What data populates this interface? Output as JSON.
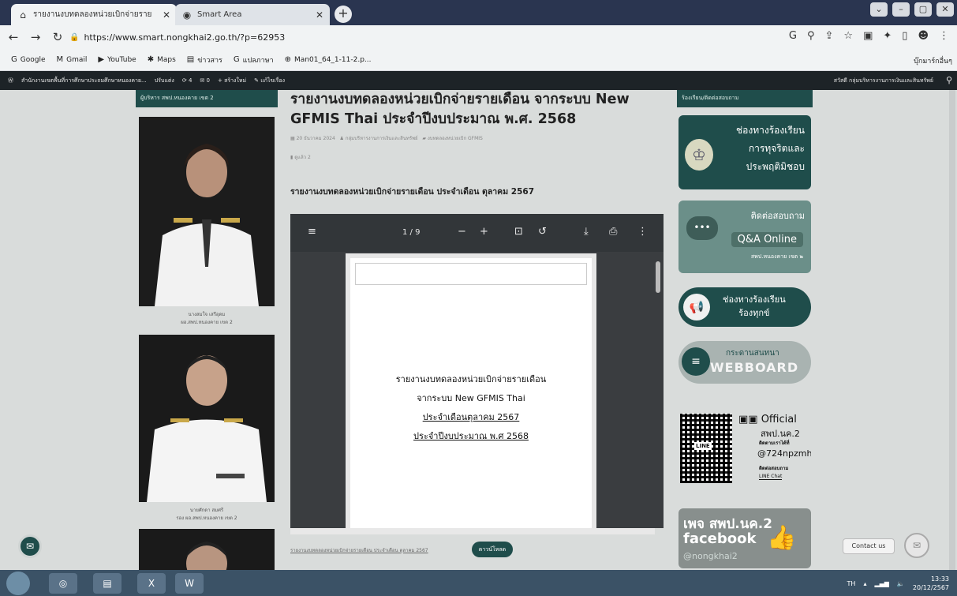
{
  "browser": {
    "tabs": [
      {
        "title": "รายงานงบทดลองหน่วยเบิกจ่ายราย",
        "active": true
      },
      {
        "title": "Smart Area",
        "active": false
      }
    ],
    "new_tab": "+",
    "url": "https://www.smart.nongkhai2.go.th/?p=62953",
    "bookmarks": [
      {
        "icon": "G",
        "label": "Google"
      },
      {
        "icon": "M",
        "label": "Gmail"
      },
      {
        "icon": "▶",
        "label": "YouTube"
      },
      {
        "icon": "✱",
        "label": "Maps"
      },
      {
        "icon": "▤",
        "label": "ข่าวสาร"
      },
      {
        "icon": "G",
        "label": "แปลภาษา"
      },
      {
        "icon": "⊕",
        "label": "Man01_64_1-11-2.p..."
      }
    ],
    "bookmarks_right": "บุ๊กมาร์กอื่นๆ"
  },
  "wp_admin": {
    "site": "สำนักงานเขตพื้นที่การศึกษาประถมศึกษาหนองคาย...",
    "customize": "ปรับแต่ง",
    "updates": "4",
    "comments": "0",
    "new": "สร้างใหม่",
    "edit": "แก้ไขเรื่อง",
    "right": "สวัสดี กลุ่มบริหารงานการเงินและสินทรัพย์"
  },
  "left_sidebar": {
    "heading": "ผู้บริหาร สพป.หนองคาย เขต 2",
    "person1_name": "นางสมใจ เสรีอุดม",
    "person1_role": "ผอ.สพป.หนองคาย เขต 2",
    "person2_name": "นายศักดา สมศรี",
    "person2_role": "รอง ผอ.สพป.หนองคาย เขต 2"
  },
  "post": {
    "title": "รายงานงบทดลองหน่วยเบิกจ่ายรายเดือน จากระบบ New GFMIS Thai ประจำปีงบประมาณ พ.ศ. 2568",
    "meta_date": "20 ธันวาคม 2024",
    "meta_author": "กลุ่มบริหารงานการเงินและสินทรัพย์",
    "meta_category": "งบทดลองหน่วยเบิก GFMIS",
    "meta_views": "ดูแล้ว 2",
    "subheading": "รายงานงบทดลองหน่วยเบิกจ่ายรายเดือน ประจำเดือน ตุลาคม 2567",
    "pdf": {
      "page_indicator": "1 / 9",
      "line1": "รายงานงบทดลองหน่วยเบิกจ่ายรายเดือน",
      "line2": "จากระบบ New GFMIS Thai",
      "line3": "ประจำเดือนตุลาคม 2567",
      "line4": "ประจำปีงบประมาณ พ.ศ 2568"
    },
    "download_text": "รายงานงบทดลองหน่วยเบิกจ่ายรายเดือน ประจำเดือน ตุลาคม 2567",
    "download_button": "ดาวน์โหลด"
  },
  "right_sidebar": {
    "heading": "ร้องเรียน/ติดต่อสอบถาม",
    "banner1": [
      "ช่องทางร้องเรียน",
      "การทุจริตและ",
      "ประพฤติมิชอบ"
    ],
    "banner2_title": "ติดต่อสอบถาม",
    "banner2_main": "Q&A Online",
    "banner2_sub": "สพป.หนองคาย เขต ๒",
    "banner3": [
      "ช่องทางร้องเรียน",
      "ร้องทุกข์"
    ],
    "banner4_title": "กระดานสนทนา",
    "banner4_main": "WEBBOARD",
    "line_official": "Official",
    "line_org": "สพป.นค.2",
    "line_add": "ติดตามเราได้ที่",
    "line_id": "@724npzmh",
    "line_contact": "ติดต่อสอบถาม",
    "line_chat": "LINE Chat",
    "line_qr_label": "LINE",
    "fb_page": "เพจ สพป.นค.2",
    "fb_name": "facebook",
    "fb_handle": "@nongkhai2"
  },
  "widgets": {
    "contact_us": "Contact us"
  },
  "taskbar": {
    "lang": "TH",
    "time": "13:33",
    "date": "20/12/2567"
  },
  "colors": {
    "brand_green": "#1f4d4b",
    "wp_bar": "#1d2327",
    "taskbar": "#3b5266"
  }
}
